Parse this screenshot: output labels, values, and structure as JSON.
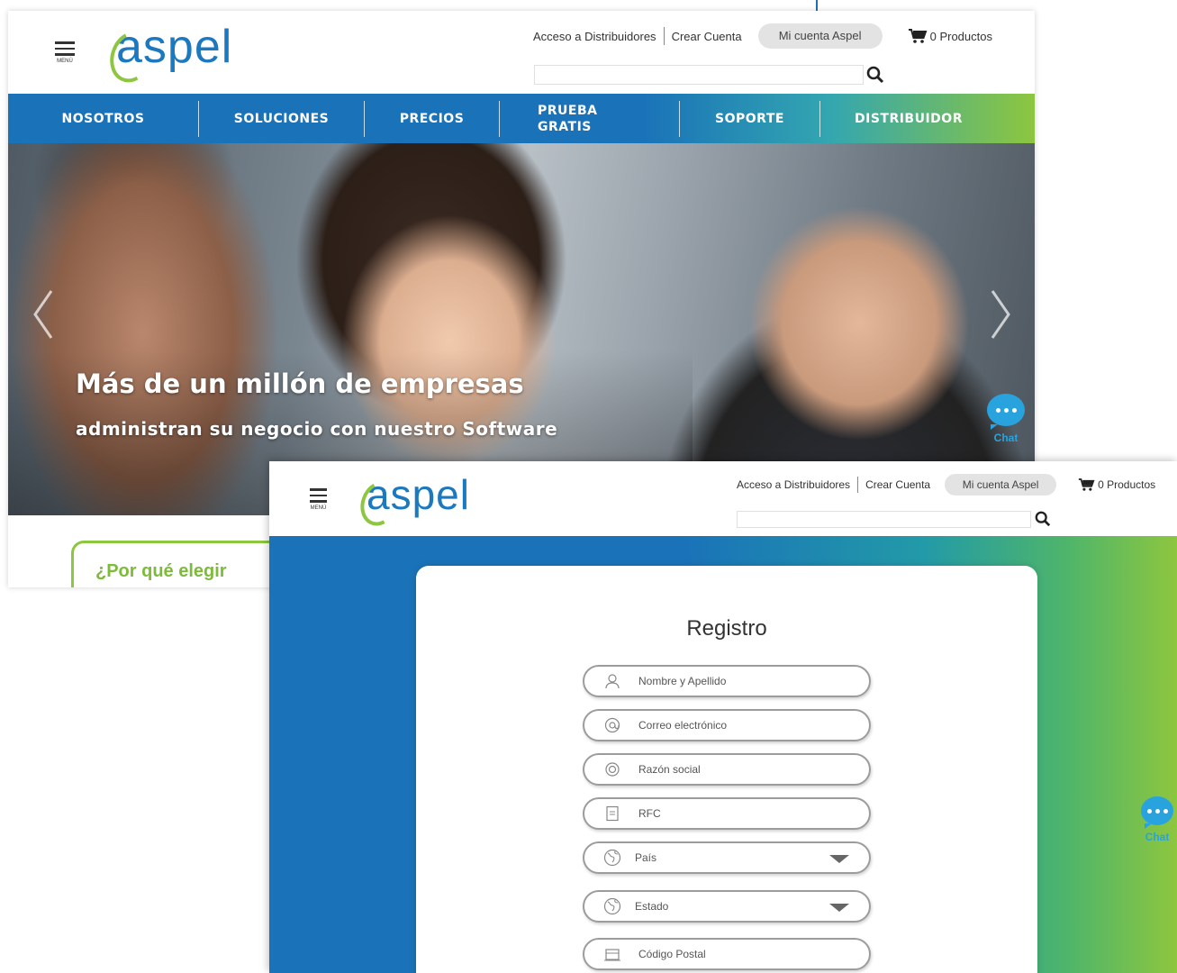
{
  "brand": {
    "logo_text": "aspel",
    "accent_blue": "#1a73b8",
    "accent_green": "#8dc63f",
    "chat_color": "#29a3dd"
  },
  "header": {
    "menu_label": "MENÚ",
    "distribuidores_link": "Acceso a Distribuidores",
    "crear_cuenta_link": "Crear Cuenta",
    "mi_cuenta_button": "Mi cuenta Aspel",
    "cart_label": "0 Productos",
    "search_placeholder": ""
  },
  "nav": {
    "items": [
      {
        "label": "NOSOTROS"
      },
      {
        "label": "SOLUCIONES"
      },
      {
        "label": "PRECIOS"
      },
      {
        "label_line1": "PRUEBA",
        "label_line2": "GRATIS"
      },
      {
        "label": "SOPORTE"
      },
      {
        "label": "DISTRIBUIDOR"
      }
    ]
  },
  "hero": {
    "headline": "Más de un millón de empresas",
    "subline": "administran su negocio con nuestro Software"
  },
  "chat": {
    "label": "Chat"
  },
  "why": {
    "title": "¿Por qué elegir"
  },
  "registro": {
    "title": "Registro",
    "fields": [
      {
        "placeholder": "Nombre y Apellido",
        "icon": "user-icon"
      },
      {
        "placeholder": "Correo electrónico",
        "icon": "at-icon"
      },
      {
        "placeholder": "Razón social",
        "icon": "company-icon"
      },
      {
        "placeholder": "RFC",
        "icon": "document-icon"
      },
      {
        "placeholder": "País",
        "icon": "globe-icon",
        "dropdown": true
      },
      {
        "placeholder": "Estado",
        "icon": "globe-icon",
        "dropdown": true
      },
      {
        "placeholder": "Código Postal",
        "icon": "mailbox-icon"
      }
    ]
  }
}
